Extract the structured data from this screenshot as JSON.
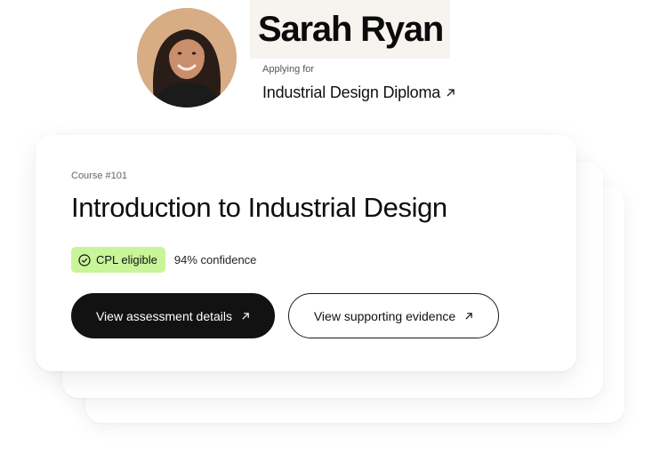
{
  "applicant": {
    "name": "Sarah Ryan",
    "applying_label": "Applying for",
    "program": "Industrial Design Diploma"
  },
  "card": {
    "course_number": "Course #101",
    "course_title": "Introduction to Industrial Design",
    "badge_label": "CPL eligible",
    "confidence": "94% confidence",
    "primary_button": "View assessment details",
    "secondary_button": "View supporting evidence"
  },
  "icons": {
    "program_arrow": "arrow-up-right-icon",
    "badge_check": "check-circle-icon",
    "button_arrow": "arrow-up-right-icon"
  },
  "colors": {
    "badge_bg": "#c9f59a",
    "primary_button_bg": "#121212",
    "name_box_bg": "#f7f4f0"
  }
}
